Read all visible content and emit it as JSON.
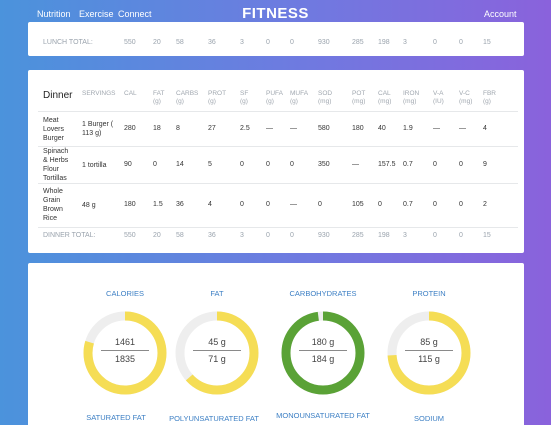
{
  "nav": {
    "links": [
      "Nutrition",
      "Exercise",
      "Connect"
    ],
    "brand": "FITNESS",
    "account": "Account"
  },
  "lunch_totals": {
    "label": "LUNCH TOTAL:",
    "values": [
      "550",
      "20",
      "58",
      "36",
      "3",
      "0",
      "0",
      "930",
      "285",
      "198",
      "3",
      "0",
      "0",
      "15"
    ]
  },
  "dinner": {
    "title": "Dinner",
    "headers": [
      [
        "SERVINGS"
      ],
      [
        "CAL"
      ],
      [
        "FAT",
        "(g)"
      ],
      [
        "CARBS",
        "(g)"
      ],
      [
        "PROT",
        "(g)"
      ],
      [
        "SF",
        "(g)"
      ],
      [
        "PUFA",
        "(g)"
      ],
      [
        "MUFA",
        "(g)"
      ],
      [
        "SOD",
        "(mg)"
      ],
      [
        "POT",
        "(mg)"
      ],
      [
        "CAL",
        "(mg)"
      ],
      [
        "IRON",
        "(mg)"
      ],
      [
        "V-A",
        "(IU)"
      ],
      [
        "V-C",
        "(mg)"
      ],
      [
        "FBR",
        "(g)"
      ]
    ],
    "rows": [
      {
        "name": [
          "Meat",
          "Lovers",
          "Burger"
        ],
        "serving": [
          "1 Burger (",
          "113 g)"
        ],
        "values": [
          "280",
          "18",
          "8",
          "27",
          "2.5",
          "—",
          "—",
          "580",
          "180",
          "40",
          "1.9",
          "—",
          "—",
          "4"
        ]
      },
      {
        "name": [
          "Spinach",
          "& Herbs",
          "Flour",
          "Tortillas"
        ],
        "serving": [
          "1 tortilla"
        ],
        "values": [
          "90",
          "0",
          "14",
          "5",
          "0",
          "0",
          "0",
          "350",
          "—",
          "157.5",
          "0.7",
          "0",
          "0",
          "9"
        ]
      },
      {
        "name": [
          "Whole",
          "Grain",
          "Brown",
          "Rice"
        ],
        "serving": [
          "48 g"
        ],
        "values": [
          "180",
          "1.5",
          "36",
          "4",
          "0",
          "0",
          "—",
          "0",
          "105",
          "0",
          "0.7",
          "0",
          "0",
          "2"
        ]
      }
    ],
    "totals": {
      "label": "DINNER TOTAL:",
      "values": [
        "550",
        "20",
        "58",
        "36",
        "3",
        "0",
        "0",
        "930",
        "285",
        "198",
        "3",
        "0",
        "0",
        "15"
      ]
    }
  },
  "gauges": [
    {
      "label": "CALORIES",
      "value": "1461",
      "goal": "1835",
      "fraction": 0.796,
      "color": "#f5dd55"
    },
    {
      "label": "FAT",
      "value": "45 g",
      "goal": "71 g",
      "fraction": 0.634,
      "color": "#f5dd55"
    },
    {
      "label": "CARBOHYDRATES",
      "value": "180 g",
      "goal": "184 g",
      "fraction": 0.978,
      "color": "#5aa236"
    },
    {
      "label": "PROTEIN",
      "value": "85 g",
      "goal": "115 g",
      "fraction": 0.739,
      "color": "#f5dd55"
    }
  ],
  "gauge_labels_row2": [
    "SATURATED FAT",
    "POLYUNSATURATED FAT",
    "MONOUNSATURATED FAT",
    "SODIUM"
  ],
  "colors": {
    "track": "#eeeeee",
    "link": "#3c7fc4"
  }
}
